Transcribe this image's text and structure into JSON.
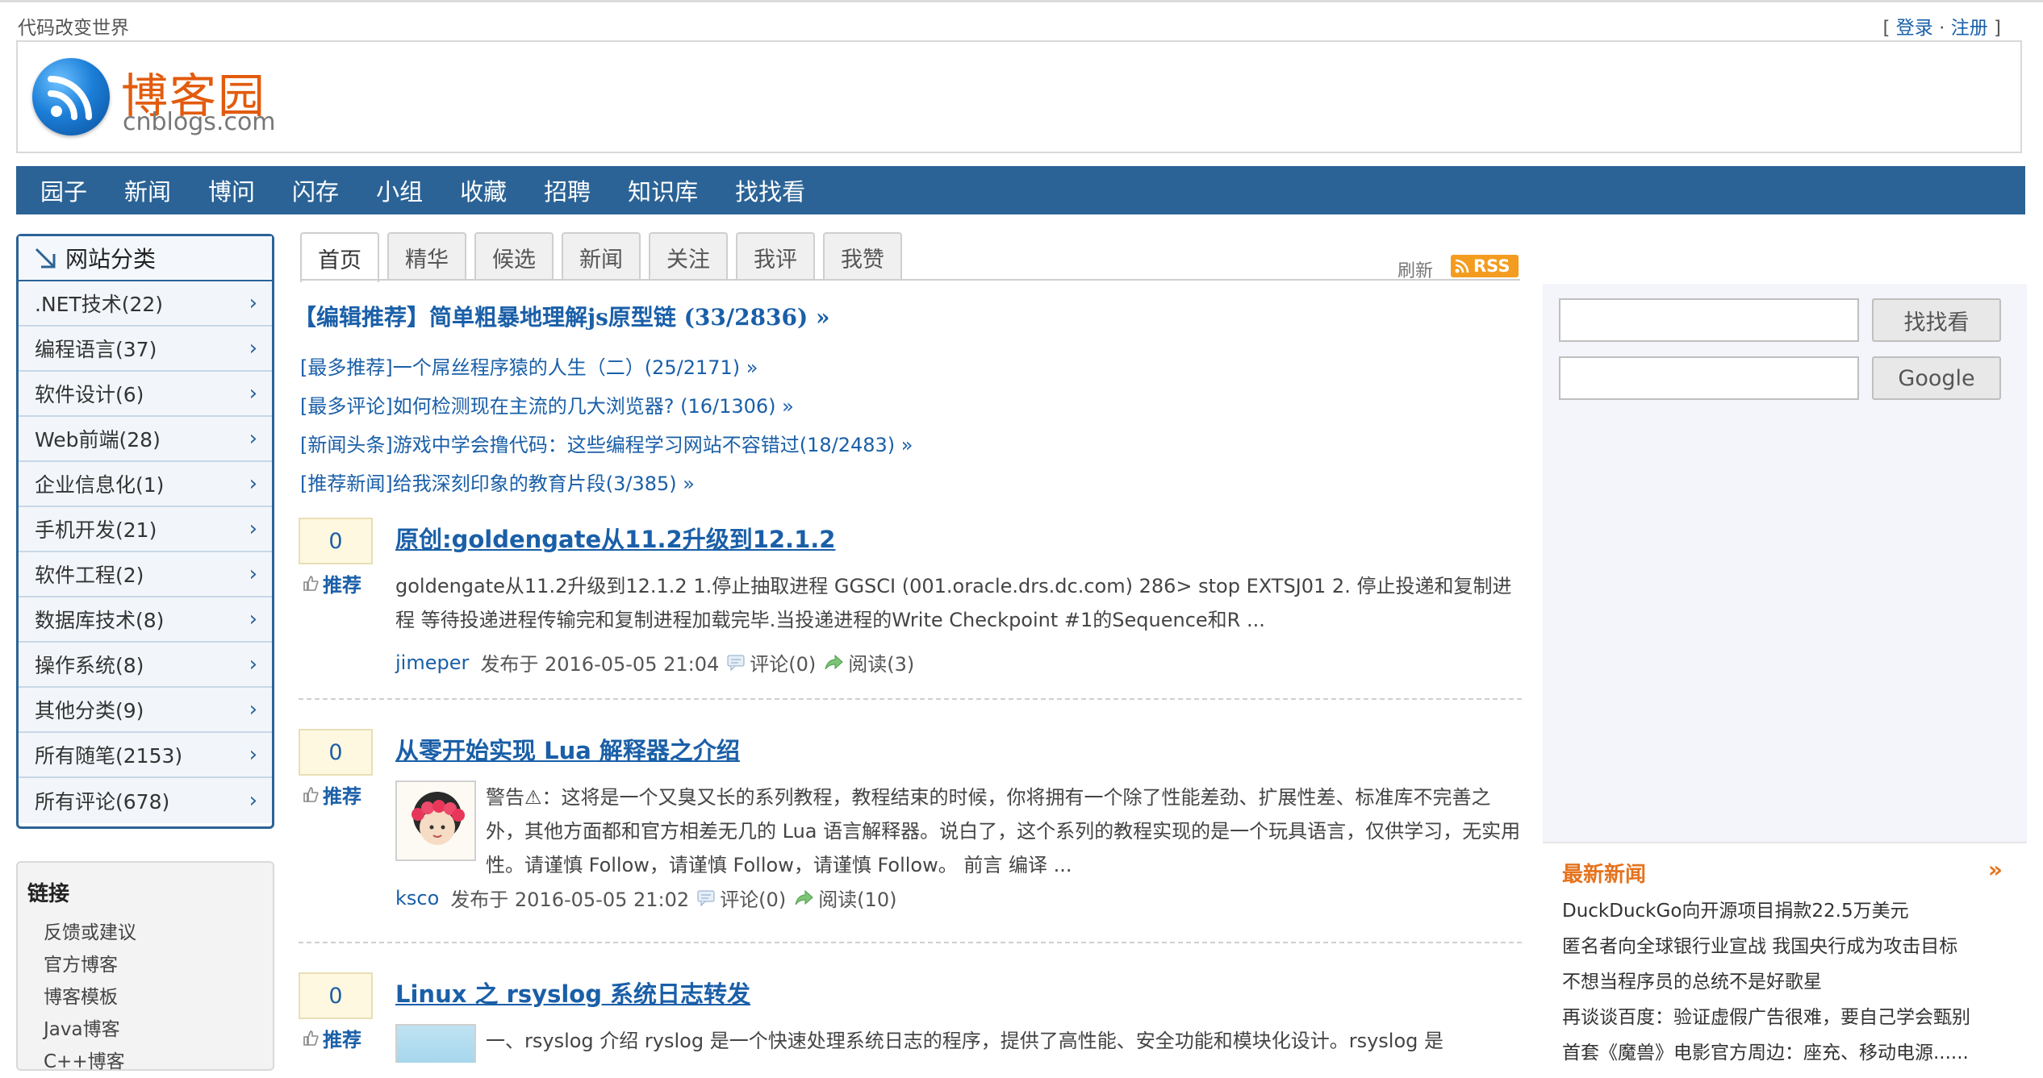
{
  "topbar": {
    "slogan": "代码改变世界",
    "bracket_open": "[",
    "login": "登录",
    "dot": "·",
    "register": "注册",
    "bracket_close": "]"
  },
  "logo": {
    "cn": "博客园",
    "en": "cnblogs.com"
  },
  "nav": [
    "园子",
    "新闻",
    "博问",
    "闪存",
    "小组",
    "收藏",
    "招聘",
    "知识库",
    "找找看"
  ],
  "categories": {
    "title": "网站分类",
    "items": [
      ".NET技术(22)",
      "编程语言(37)",
      "软件设计(6)",
      "Web前端(28)",
      "企业信息化(1)",
      "手机开发(21)",
      "软件工程(2)",
      "数据库技术(8)",
      "操作系统(8)",
      "其他分类(9)",
      "所有随笔(2153)",
      "所有评论(678)"
    ]
  },
  "links": {
    "title": "链接",
    "items": [
      "反馈或建议",
      "官方博客",
      "博客模板",
      "Java博客",
      "C++博客"
    ]
  },
  "tabs": [
    "首页",
    "精华",
    "候选",
    "新闻",
    "关注",
    "我评",
    "我赞"
  ],
  "toolbar": {
    "refresh": "刷新",
    "rss": "RSS"
  },
  "headline": "【编辑推荐】简单粗暴地理解js原型链 (33/2836) »",
  "sublines": [
    "[最多推荐]一个屌丝程序猿的人生（二）(25/2171) »",
    "[最多评论]如何检测现在主流的几大浏览器? (16/1306) »",
    "[新闻头条]游戏中学会撸代码：这些编程学习网站不容错过(18/2483) »",
    "[推荐新闻]给我深刻印象的教育片段(3/385) »"
  ],
  "posts": [
    {
      "digg": "0",
      "digg_label": "推荐",
      "title": "原创:goldengate从11.2升级到12.1.2",
      "summary": "goldengate从11.2升级到12.1.2 1.停止抽取进程 GGSCI (001.oracle.drs.dc.com) 286> stop EXTSJ01 2. 停止投递和复制进程 等待投递进程传输完和复制进程加载完毕.当投递进程的Write Checkpoint #1的Sequence和R ...",
      "author": "jimeper",
      "published": "发布于 2016-05-05 21:04",
      "comments": "评论(0)",
      "reads": "阅读(3)"
    },
    {
      "digg": "0",
      "digg_label": "推荐",
      "title": "从零开始实现 Lua 解释器之介绍",
      "summary": "警告⚠：这将是一个又臭又长的系列教程，教程结束的时候，你将拥有一个除了性能差劲、扩展性差、标准库不完善之外，其他方面都和官方相差无几的 Lua 语言解释器。说白了，这个系列的教程实现的是一个玩具语言，仅供学习，无实用性。请谨慎 Follow，请谨慎 Follow，请谨慎 Follow。 前言 编译 ...",
      "author": "ksco",
      "published": "发布于 2016-05-05 21:02",
      "comments": "评论(0)",
      "reads": "阅读(10)"
    },
    {
      "digg": "0",
      "digg_label": "推荐",
      "title": "Linux 之 rsyslog 系统日志转发",
      "summary": "一、rsyslog 介绍 ryslog 是一个快速处理系统日志的程序，提供了高性能、安全功能和模块化设计。rsyslog 是"
    }
  ],
  "search": {
    "button1": "找找看",
    "button2": "Google"
  },
  "news": {
    "title": "最新新闻",
    "more": "»",
    "items": [
      "DuckDuckGo向开源项目捐款22.5万美元",
      "匿名者向全球银行业宣战 我国央行成为攻击目标",
      "不想当程序员的总统不是好歌星",
      "再谈谈百度：验证虚假广告很难，要自己学会甄别",
      "首套《魔兽》电影官方周边：座充、移动电源......"
    ]
  },
  "colors": {
    "nav_bg": "#2b6396",
    "link": "#1a5fa8",
    "logo_orange": "#e25b0e",
    "rss": "#f39c1f",
    "news_title": "#e5731d"
  }
}
